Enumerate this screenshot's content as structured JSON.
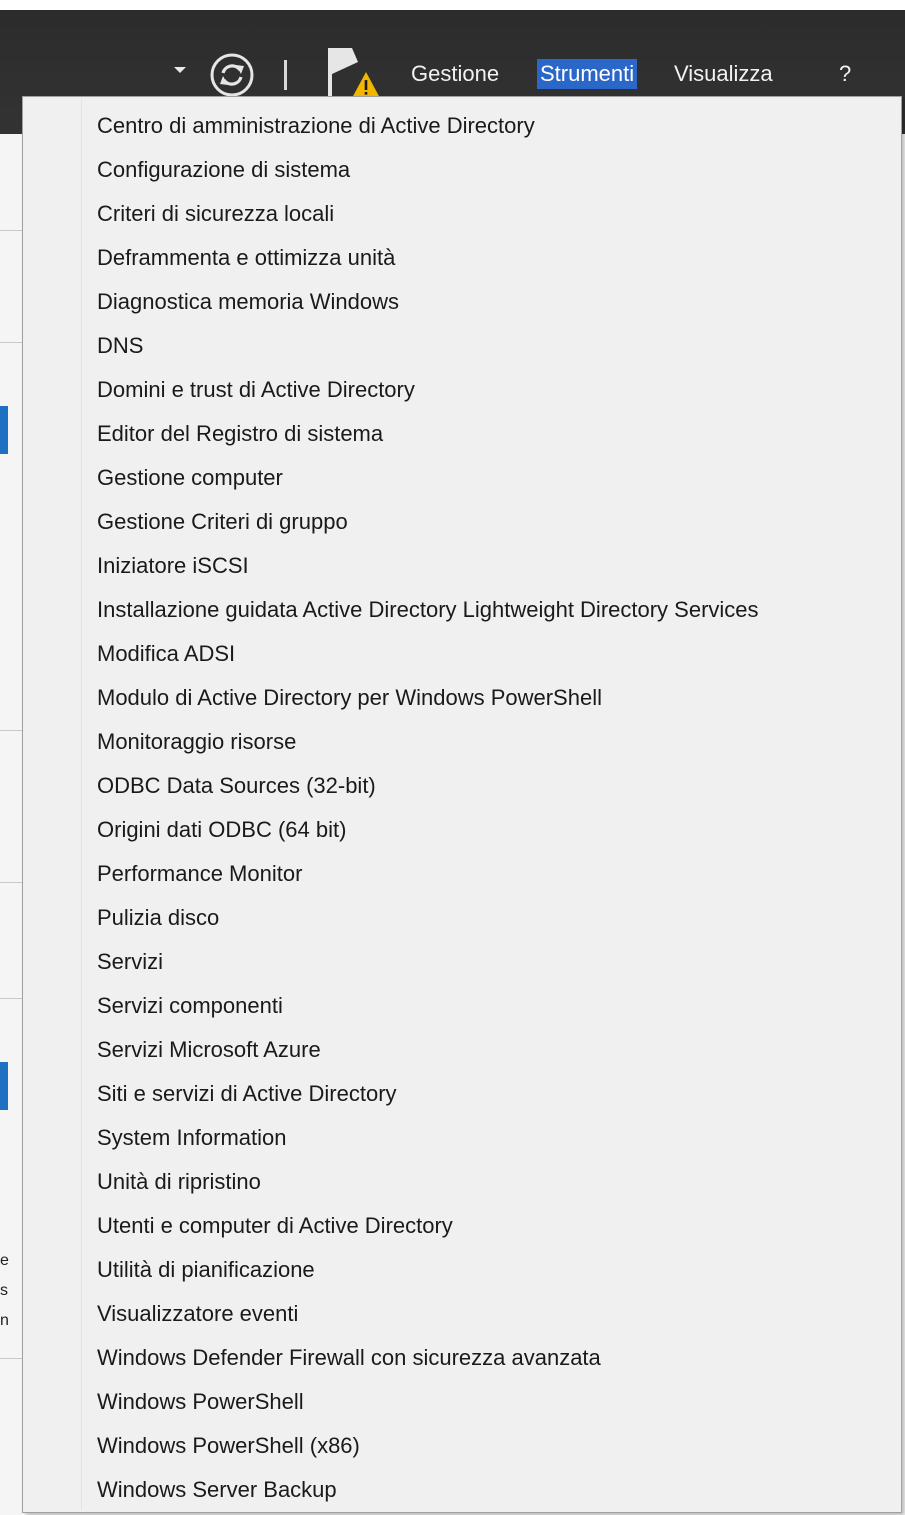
{
  "menubar": {
    "items": [
      {
        "label": "Gestione"
      },
      {
        "label": "Strumenti"
      },
      {
        "label": "Visualizza"
      },
      {
        "label": "?"
      }
    ],
    "active": "Strumenti",
    "icons": [
      "dropdown-caret-icon",
      "refresh-icon",
      "flag-icon",
      "warning-icon"
    ]
  },
  "background": {
    "fragments": [
      "e",
      "s",
      "n"
    ]
  },
  "tools_menu": {
    "items": [
      "Centro di amministrazione di Active Directory",
      "Configurazione di sistema",
      "Criteri di sicurezza locali",
      "Deframmenta e ottimizza unità",
      "Diagnostica memoria Windows",
      "DNS",
      "Domini e trust di Active Directory",
      "Editor del Registro di sistema",
      "Gestione computer",
      "Gestione Criteri di gruppo",
      "Iniziatore iSCSI",
      "Installazione guidata Active Directory Lightweight Directory Services",
      "Modifica ADSI",
      "Modulo di Active Directory per Windows PowerShell",
      "Monitoraggio risorse",
      "ODBC Data Sources (32-bit)",
      "Origini dati ODBC (64 bit)",
      "Performance Monitor",
      "Pulizia disco",
      "Servizi",
      "Servizi componenti",
      "Servizi Microsoft Azure",
      "Siti e servizi di Active Directory",
      "System Information",
      "Unità di ripristino",
      "Utenti e computer di Active Directory",
      "Utilità di pianificazione",
      "Visualizzatore eventi",
      "Windows Defender Firewall con sicurezza avanzata",
      "Windows PowerShell",
      "Windows PowerShell (x86)",
      "Windows Server Backup"
    ]
  },
  "colors": {
    "header_bg": "#2b2b2b",
    "active_menu": "#2a67c8",
    "menu_bg": "#f0f0f0",
    "warning": "#f2b600"
  }
}
